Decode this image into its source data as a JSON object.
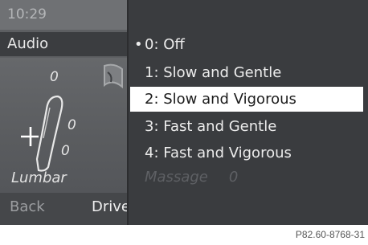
{
  "status": {
    "time": "10:29"
  },
  "header": {
    "title": "Audio"
  },
  "seat": {
    "value_top": "0",
    "value_mid": "0",
    "value_low": "0",
    "label": "Lumbar"
  },
  "softkeys": {
    "back": "Back",
    "drive": "Drive"
  },
  "menu": {
    "items": [
      {
        "label": "0: Off",
        "active": true
      },
      {
        "label": "1: Slow and Gentle"
      },
      {
        "label": "2: Slow and Vigorous",
        "selected": true
      },
      {
        "label": "3: Fast and Gentle"
      },
      {
        "label": "4: Fast and Vigorous"
      }
    ],
    "disabled_label": "Massage",
    "disabled_value": "0"
  },
  "caption": "P82.60-8768-31"
}
